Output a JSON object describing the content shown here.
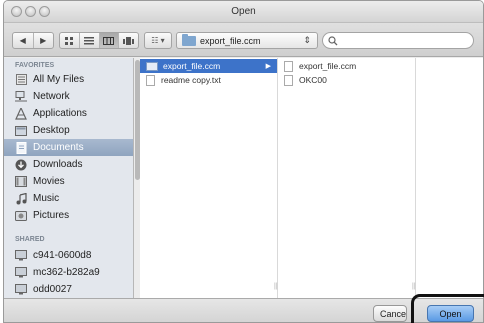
{
  "window": {
    "title": "Open"
  },
  "toolbar": {
    "back_glyph": "◀",
    "forward_glyph": "▶",
    "view_icons": [
      "icon-view-icon",
      "list-view-icon",
      "column-view-icon",
      "coverflow-view-icon"
    ],
    "arrange_glyph": "☷ ▾",
    "path_selector": "export_file.ccm",
    "path_arrows": "⇕",
    "search_value": ""
  },
  "sidebar": {
    "favorites_header": "FAVORITES",
    "favorites": [
      {
        "label": "All My Files",
        "icon": "all-files-icon",
        "selected": false
      },
      {
        "label": "Network",
        "icon": "network-icon",
        "selected": false
      },
      {
        "label": "Applications",
        "icon": "applications-icon",
        "selected": false
      },
      {
        "label": "Desktop",
        "icon": "desktop-icon",
        "selected": false
      },
      {
        "label": "Documents",
        "icon": "documents-icon",
        "selected": true
      },
      {
        "label": "Downloads",
        "icon": "downloads-icon",
        "selected": false
      },
      {
        "label": "Movies",
        "icon": "movies-icon",
        "selected": false
      },
      {
        "label": "Music",
        "icon": "music-icon",
        "selected": false
      },
      {
        "label": "Pictures",
        "icon": "pictures-icon",
        "selected": false
      }
    ],
    "shared_header": "SHARED",
    "shared": [
      {
        "label": "c941-0600d8",
        "icon": "shared-computer-icon"
      },
      {
        "label": "mc362-b282a9",
        "icon": "shared-computer-icon"
      },
      {
        "label": "odd0027",
        "icon": "shared-computer-icon"
      }
    ]
  },
  "browser": {
    "column1": [
      {
        "label": "export_file.ccm",
        "type": "folder",
        "selected": true,
        "arrow": "▶"
      },
      {
        "label": "readme copy.txt",
        "type": "file",
        "selected": false
      }
    ],
    "column2": [
      {
        "label": "export_file.ccm",
        "type": "file"
      },
      {
        "label": "OKC00",
        "type": "file"
      }
    ]
  },
  "buttons": {
    "cancel": "Cancel",
    "open": "Open"
  },
  "colors": {
    "selection": "#3d73c9",
    "sidebar_selection": "#94a8c2",
    "open_button": "#5a9ae4"
  }
}
